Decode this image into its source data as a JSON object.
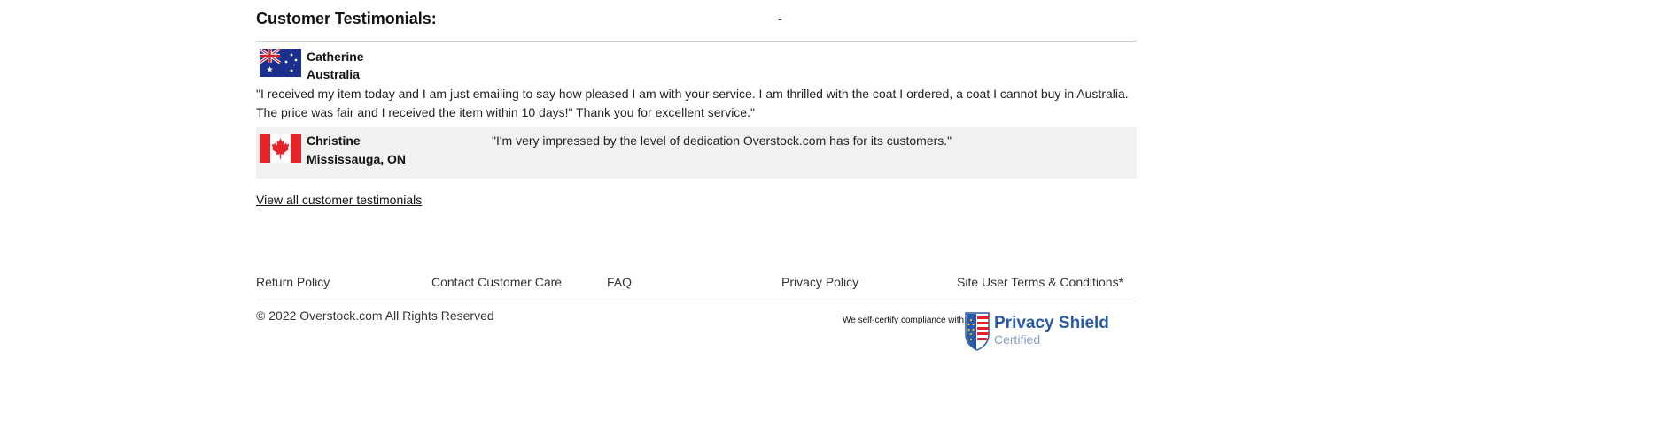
{
  "testimonials": {
    "heading": "Customer Testimonials:",
    "header_dash": "-",
    "items": [
      {
        "name": "Catherine",
        "location": "Australia",
        "flag_icon": "australia-flag-icon",
        "quote": "\"I received my item today and I am just emailing to say how pleased I am with your service. I am thrilled with the coat I ordered, a coat I cannot buy in Australia. The price was fair and I received the item within 10 days!\" Thank you for excellent service.\""
      },
      {
        "name": "Christine",
        "location": "Mississauga, ON",
        "flag_icon": "canada-flag-icon",
        "quote": "\"I'm very impressed by the level of dedication Overstock.com has for its customers.\""
      }
    ],
    "view_all_label": "View all customer testimonials"
  },
  "footer": {
    "links": [
      {
        "label": "Return Policy"
      },
      {
        "label": "Contact Customer Care"
      },
      {
        "label": "FAQ"
      },
      {
        "label": "Privacy Policy"
      },
      {
        "label": "Site User Terms & Conditions*"
      }
    ],
    "copyright": "© 2022 Overstock.com All Rights Reserved",
    "self_certify": "We self-certify compliance with:",
    "privacy_shield_title": "Privacy Shield",
    "privacy_shield_sub": "Certified",
    "privacy_shield_icon": "privacy-shield-logo-icon"
  },
  "colors": {
    "accent_blue": "#2b5aa6",
    "highlight_row": "#f1f1ef"
  }
}
